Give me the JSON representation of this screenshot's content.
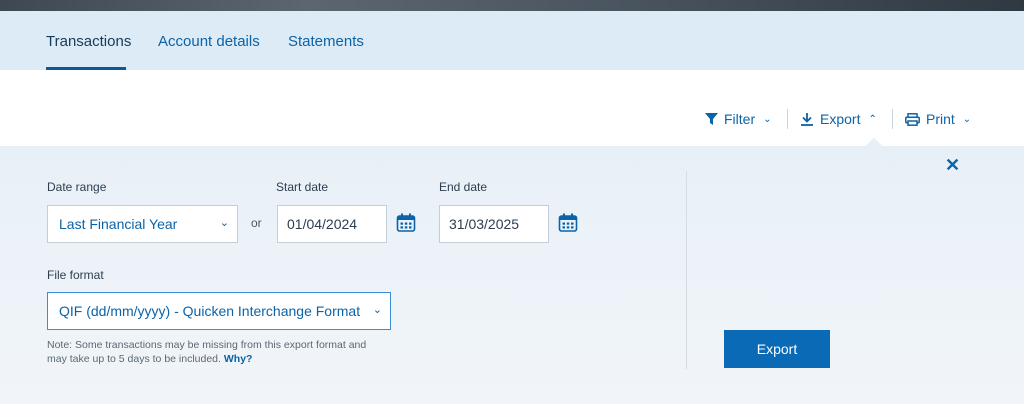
{
  "tabs": [
    {
      "label": "Transactions",
      "active": true
    },
    {
      "label": "Account details",
      "active": false
    },
    {
      "label": "Statements",
      "active": false
    }
  ],
  "toolbar": {
    "filter_label": "Filter",
    "export_label": "Export",
    "print_label": "Print"
  },
  "export_panel": {
    "date_range_label": "Date range",
    "date_range_value": "Last Financial Year",
    "or_text": "or",
    "start_date_label": "Start date",
    "start_date_value": "01/04/2024",
    "end_date_label": "End date",
    "end_date_value": "31/03/2025",
    "file_format_label": "File format",
    "file_format_value": "QIF (dd/mm/yyyy) - Quicken Interchange Format",
    "note_text": "Note: Some transactions may be missing from this export format and may take up to 5 days to be included.",
    "why_link": "Why?",
    "export_button": "Export"
  },
  "colors": {
    "accent": "#0b63a8",
    "button": "#0a6ab5",
    "tab_bar": "#dcebf5",
    "panel": "#e8f0f7"
  }
}
